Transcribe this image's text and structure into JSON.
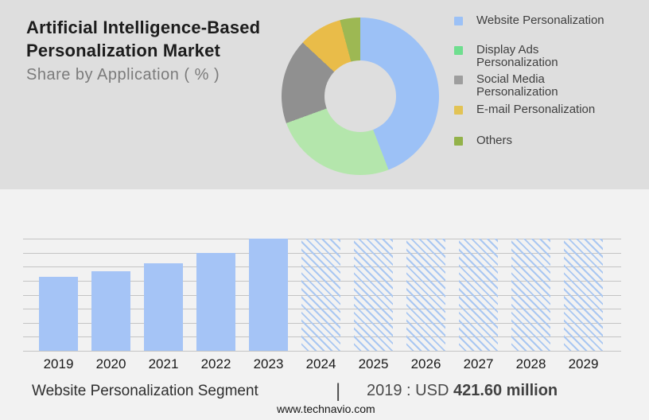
{
  "header": {
    "title_line1": "Artificial Intelligence-Based",
    "title_line2": "Personalization Market",
    "subtitle": "Share by Application ( % )"
  },
  "colors": {
    "top_background": "#DEDEDE",
    "bottom_background": "#F2F2F2",
    "bar_solid": "#A5C4F6",
    "bar_hatch_line": "#A9C7F2",
    "gridline": "#C4C4C4"
  },
  "chart_data": [
    {
      "type": "pie",
      "donut": true,
      "title": "Share by Application ( % )",
      "legend_position": "right",
      "start_angle_deg": 0,
      "direction": "clockwise",
      "segments": [
        {
          "label": "Website Personalization",
          "label_lines": [
            "Website Personalization"
          ],
          "value_pct": 44,
          "start_deg": 0,
          "end_deg": 159,
          "color": "#9CC1F6",
          "legend_color": "#9CC1F6"
        },
        {
          "label": "Display Ads Personalization",
          "label_lines": [
            "Display Ads",
            "Personalization"
          ],
          "value_pct": 25,
          "start_deg": 159,
          "end_deg": 250,
          "color": "#B4E6AC",
          "legend_color": "#6FDE8F"
        },
        {
          "label": "Social Media Personalization",
          "label_lines": [
            "Social Media",
            "Personalization"
          ],
          "value_pct": 18,
          "start_deg": 250,
          "end_deg": 313,
          "color": "#909090",
          "legend_color": "#9E9E9E"
        },
        {
          "label": "E-mail Personalization",
          "label_lines": [
            "E-mail Personalization"
          ],
          "value_pct": 9,
          "start_deg": 313,
          "end_deg": 345,
          "color": "#E9BC49",
          "legend_color": "#E2C355"
        },
        {
          "label": "Others",
          "label_lines": [
            "Others"
          ],
          "value_pct": 4,
          "start_deg": 345,
          "end_deg": 360,
          "color": "#9DB853",
          "legend_color": "#93B24A"
        }
      ]
    },
    {
      "type": "bar",
      "title": "Website Personalization Segment",
      "unit": "USD million",
      "grid": true,
      "gridline_count": 9,
      "y_axis_labels_shown": false,
      "categories": [
        "2019",
        "2020",
        "2021",
        "2022",
        "2023",
        "2024",
        "2025",
        "2026",
        "2027",
        "2028",
        "2029"
      ],
      "series": [
        {
          "name": "Website Personalization market size",
          "rel_heights": [
            0.66,
            0.709,
            0.78,
            0.872,
            1,
            1,
            1,
            1,
            1,
            1,
            1
          ],
          "styles": [
            "solid",
            "solid",
            "solid",
            "solid",
            "solid",
            "hatched",
            "hatched",
            "hatched",
            "hatched",
            "hatched",
            "hatched"
          ],
          "approx_values_usd_million": [
            421.6,
            453,
            499,
            558,
            639,
            null,
            null,
            null,
            null,
            null,
            null
          ],
          "known_values": {
            "2019": "421.60"
          },
          "forecast_years_hatched": [
            "2024",
            "2025",
            "2026",
            "2027",
            "2028",
            "2029"
          ]
        }
      ]
    }
  ],
  "caption": {
    "segment_label": "Website Personalization Segment",
    "divider": "|",
    "value_prefix": "2019 : USD ",
    "value_bold": "421.60 million"
  },
  "footer": {
    "url": "www.technavio.com"
  }
}
